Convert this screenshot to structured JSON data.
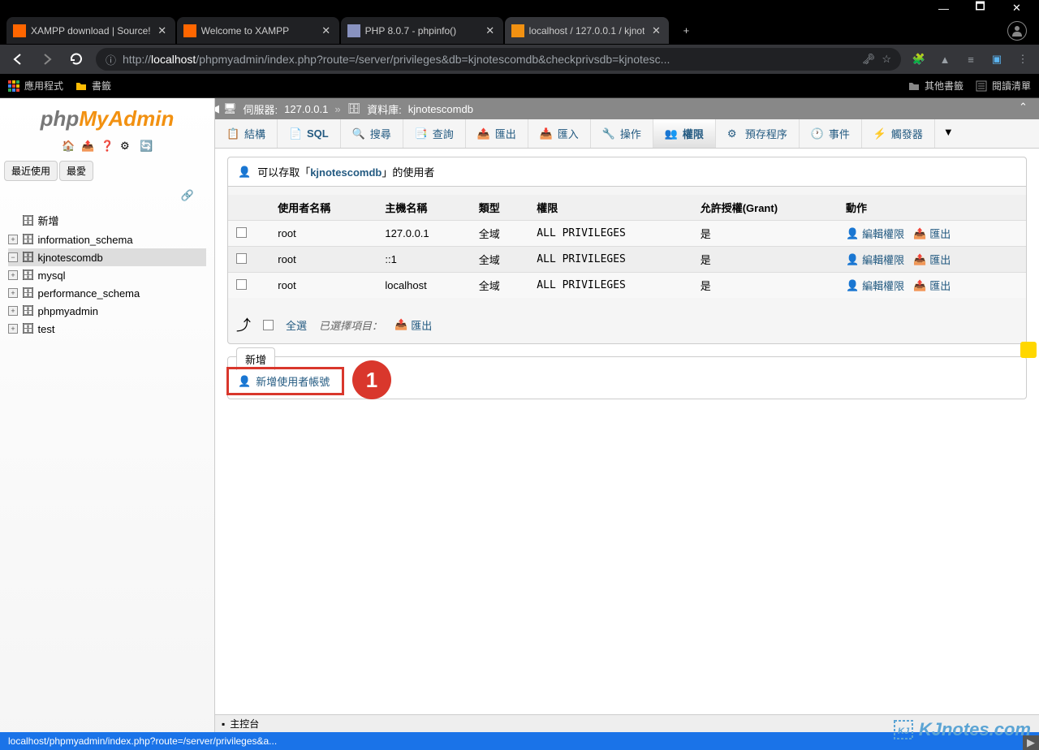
{
  "window": {
    "minimize": "—",
    "maximize": "🗖",
    "close": "✕"
  },
  "tabs": [
    {
      "title": "XAMPP download | Source!",
      "favicon": "#ff6600"
    },
    {
      "title": "Welcome to XAMPP",
      "favicon": "#ff6600"
    },
    {
      "title": "PHP 8.0.7 - phpinfo()",
      "favicon": "#8892bf"
    },
    {
      "title": "localhost / 127.0.0.1 / kjnot",
      "favicon": "#f29111",
      "active": true
    }
  ],
  "url": {
    "prefix": "http://",
    "host": "localhost",
    "path": "/phpmyadmin/index.php?route=/server/privileges&db=kjnotescomdb&checkprivsdb=kjnotesc..."
  },
  "bookmarks": {
    "apps": "應用程式",
    "folder": "書籤",
    "other": "其他書籤",
    "reading": "閱讀清單"
  },
  "sidebar": {
    "recent_label": "最近使用",
    "fav_label": "最愛",
    "new_label": "新增",
    "dbs": [
      "information_schema",
      "kjnotescomdb",
      "mysql",
      "performance_schema",
      "phpmyadmin",
      "test"
    ]
  },
  "breadcrumb": {
    "server_label": "伺服器:",
    "server": "127.0.0.1",
    "db_label": "資料庫:",
    "db": "kjnotescomdb"
  },
  "toptabs": {
    "structure": "結構",
    "sql": "SQL",
    "search": "搜尋",
    "query": "查詢",
    "export": "匯出",
    "import": "匯入",
    "operations": "操作",
    "privileges": "權限",
    "routines": "預存程序",
    "events": "事件",
    "triggers": "觸發器"
  },
  "panel": {
    "legend_prefix": "可以存取「",
    "legend_db": "kjnotescomdb",
    "legend_suffix": "」的使用者",
    "headers": {
      "user": "使用者名稱",
      "host": "主機名稱",
      "type": "類型",
      "priv": "權限",
      "grant": "允許授權(Grant)",
      "action": "動作"
    },
    "rows": [
      {
        "user": "root",
        "host": "127.0.0.1",
        "type": "全域",
        "priv": "ALL PRIVILEGES",
        "grant": "是"
      },
      {
        "user": "root",
        "host": "::1",
        "type": "全域",
        "priv": "ALL PRIVILEGES",
        "grant": "是"
      },
      {
        "user": "root",
        "host": "localhost",
        "type": "全域",
        "priv": "ALL PRIVILEGES",
        "grant": "是"
      }
    ],
    "edit_label": "編輯權限",
    "export_label": "匯出",
    "select_all": "全選",
    "selected_label": "已選擇項目：",
    "footer_export": "匯出",
    "add_tab": "新增",
    "add_user": "新增使用者帳號"
  },
  "console": {
    "label": "主控台"
  },
  "status": {
    "text": "localhost/phpmyadmin/index.php?route=/server/privileges&a..."
  },
  "watermark": "KJnotes.com",
  "callout_1": "1"
}
